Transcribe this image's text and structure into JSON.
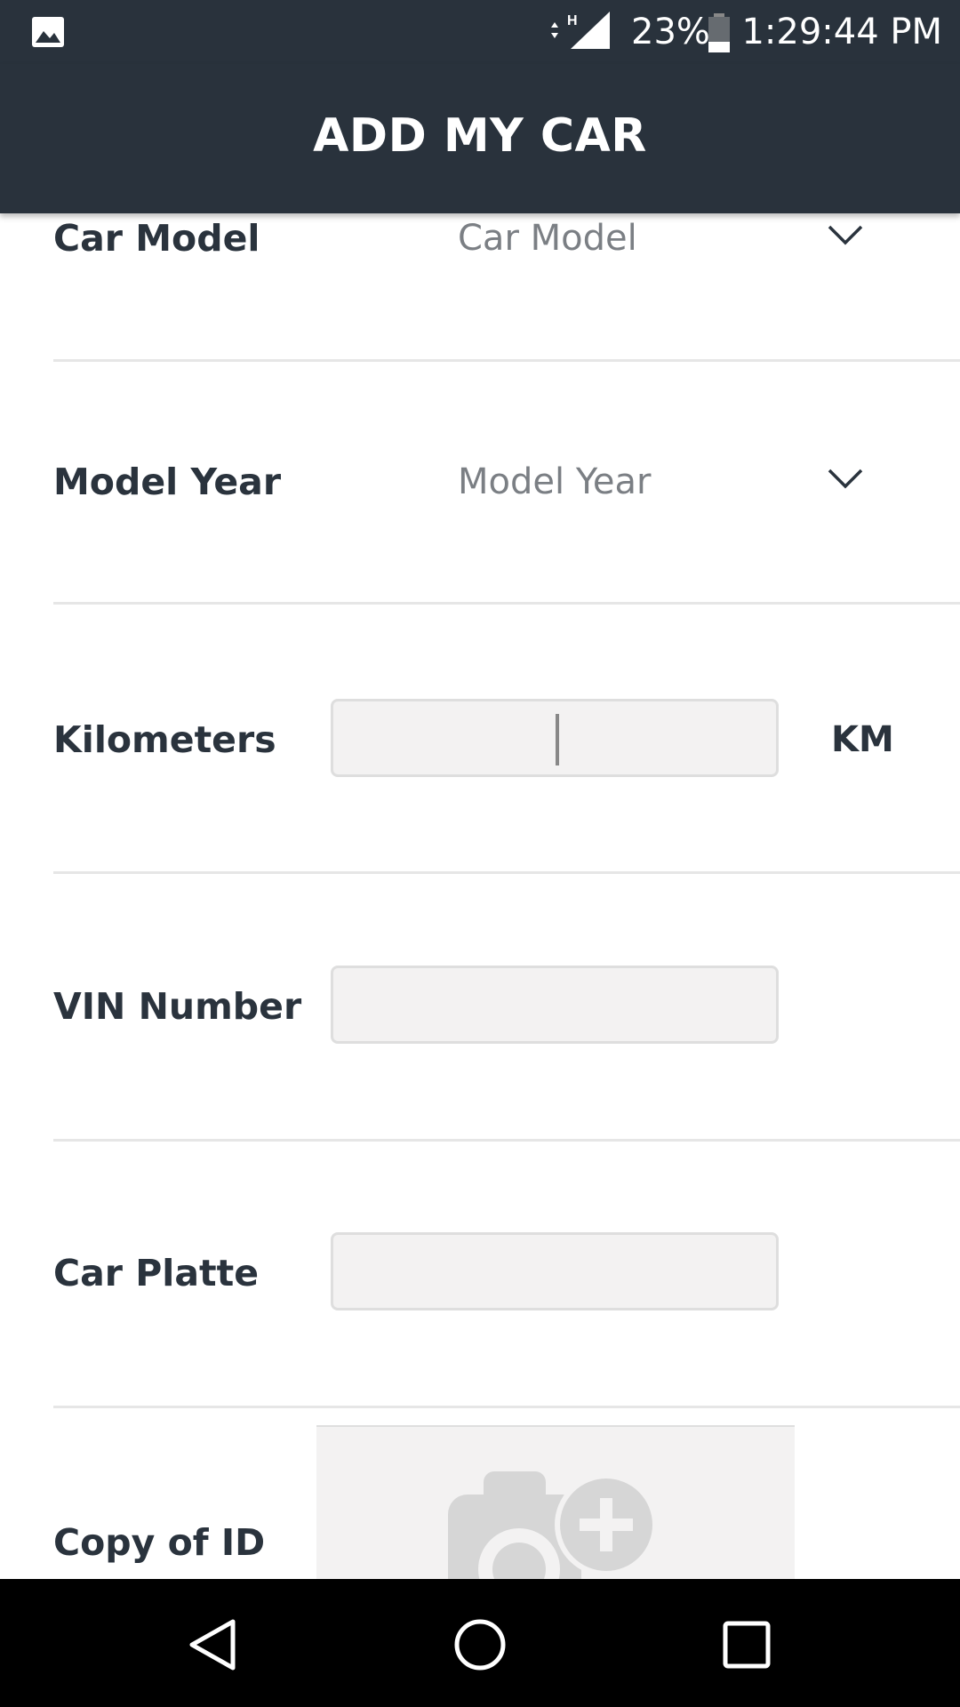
{
  "status_bar": {
    "battery": "23%",
    "time": "1:29:44 PM",
    "network_label": "H",
    "icons": [
      "image-icon",
      "network-arrows-icon",
      "signal-icon",
      "battery-icon"
    ]
  },
  "app_bar": {
    "title": "ADD MY CAR"
  },
  "form": {
    "car_model": {
      "label": "Car Model",
      "value": "Car Model"
    },
    "model_year": {
      "label": "Model Year",
      "value": "Model Year"
    },
    "kilometers": {
      "label": "Kilometers",
      "value": "",
      "unit": "KM"
    },
    "vin": {
      "label": "VIN Number",
      "value": ""
    },
    "plate": {
      "label": "Car Platte",
      "value": ""
    },
    "id_copy": {
      "label": "Copy of ID",
      "icon": "add-photo-icon"
    }
  },
  "nav_bar": {
    "icons": [
      "back-icon",
      "home-icon",
      "recents-icon"
    ]
  },
  "colors": {
    "header": "#29323c",
    "text": "#2a333d",
    "placeholder": "#7b7f84",
    "input_bg": "#f3f2f2"
  }
}
